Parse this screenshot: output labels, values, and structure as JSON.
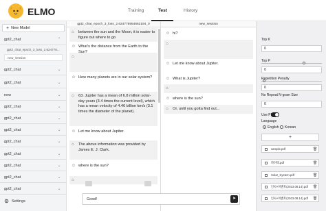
{
  "app": {
    "brand": "ELMO"
  },
  "nav": {
    "training": "Training",
    "test": "Test",
    "history": "History"
  },
  "sidebar": {
    "new_model": "New Model",
    "groups": [
      {
        "label": "gpt2_chat",
        "expanded": true
      },
      {
        "label": "gpt2_chat",
        "expanded": false
      },
      {
        "label": "gpt2_chat",
        "expanded": false
      },
      {
        "label": "new",
        "expanded": false
      },
      {
        "label": "gpt2_chat",
        "expanded": false
      },
      {
        "label": "gpt2_chat",
        "expanded": false
      },
      {
        "label": "gpt2_chat",
        "expanded": false
      },
      {
        "label": "gpt2_chat",
        "expanded": false
      },
      {
        "label": "gpt2_chat",
        "expanded": false
      },
      {
        "label": "gpt2_chat",
        "expanded": false
      },
      {
        "label": "gpt2_chat",
        "expanded": false
      },
      {
        "label": "gpt2_chat",
        "expanded": false
      },
      {
        "label": "gpt2_chat",
        "expanded": false
      },
      {
        "label": "gpt2_chat",
        "expanded": false
      }
    ],
    "subitems": [
      "gpt2_chat_epoch_3_loss_2.624778...",
      "new_session"
    ],
    "settings": "Settings"
  },
  "left_chat": {
    "header": "gpt2_chat_epoch_3_loss_2.624778954662194_0",
    "messages": [
      {
        "role": "bot",
        "text": "between the sun and the Moon, it is easier to figure out where to go"
      },
      {
        "role": "user",
        "text": "What's the distance from the Earth to the Sun?"
      },
      {
        "role": "bot",
        "text": ""
      },
      {
        "role": "user",
        "text": "How many planets are in our solar system?"
      },
      {
        "role": "bot",
        "text": "63. Jupiter has a mean of 6.8 million solar-day years (3.4 times the current level), which has a mean velocity of 4.46 billion km/s (3.1 times the diameter of the planet)."
      },
      {
        "role": "user",
        "text": "Let me know about Jupiter."
      },
      {
        "role": "bot",
        "text": "The above information was provided by James E. J. Clark."
      },
      {
        "role": "user",
        "text": "where is the sun?"
      },
      {
        "role": "bot",
        "text": ""
      }
    ]
  },
  "right_chat": {
    "header": "new_session",
    "messages": [
      {
        "role": "user",
        "text": "hi?"
      },
      {
        "role": "bot",
        "text": ""
      },
      {
        "role": "user",
        "text": "Let me know about Jupiter."
      },
      {
        "role": "user",
        "text": "What is Jupiter?"
      },
      {
        "role": "bot",
        "text": ""
      },
      {
        "role": "user",
        "text": "where is the sun?"
      },
      {
        "role": "bot",
        "text": "Or, until you gotta find out..."
      }
    ]
  },
  "input": {
    "value": "Good!",
    "send_icon": "send-icon"
  },
  "params": {
    "top_k_label": "Top K",
    "top_k_value": "0",
    "top_p_label": "Top P",
    "top_p_value": "0",
    "top_p_slider": 0.7,
    "rep_label": "Repetition Penalty",
    "rep_value": "0",
    "rep_slider": 0.05,
    "ngram_label": "No Repeat N-gram Size",
    "ngram_value": "0",
    "use_pdf_label": "Use PDF",
    "use_pdf_on": true,
    "language_label": "Language",
    "lang_english": "English",
    "lang_korean": "Korean",
    "language_selected": "English",
    "add": "+",
    "files": [
      "sample.pdf",
      "하이텍.pdf",
      "Solar_System.pdf",
      "인사+이벤트(2023.08.14).pdf",
      "인사+이벤트(2023.08.14).pdf"
    ]
  }
}
